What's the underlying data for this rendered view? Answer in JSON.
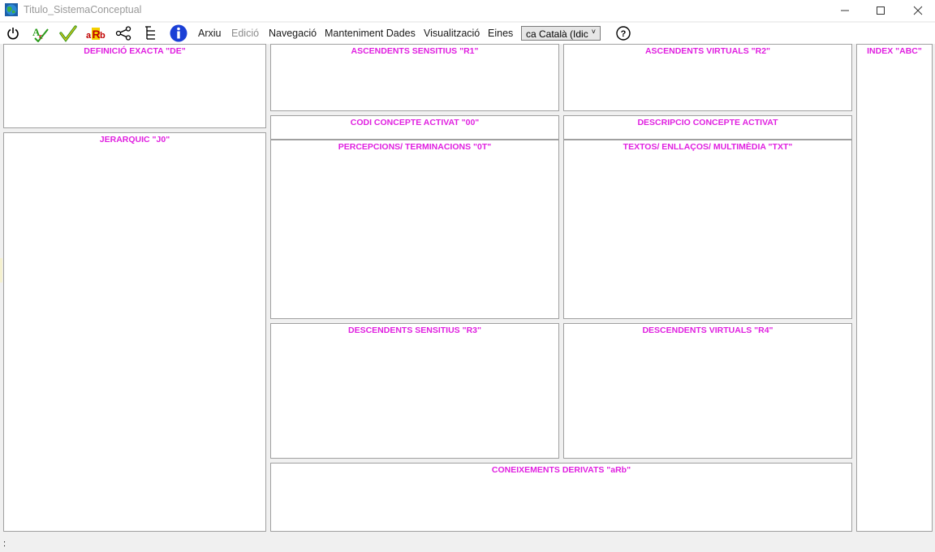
{
  "window": {
    "title": "Titulo_SistemaConceptual"
  },
  "menu": {
    "items": [
      {
        "label": "Arxiu",
        "enabled": true
      },
      {
        "label": "Edició",
        "enabled": false
      },
      {
        "label": "Navegació",
        "enabled": true
      },
      {
        "label": "Manteniment Dades",
        "enabled": true
      },
      {
        "label": "Visualització",
        "enabled": true
      },
      {
        "label": "Eines",
        "enabled": true
      }
    ],
    "language_value": "ca Català (Idic",
    "icons": [
      "power-icon",
      "spellcheck-icon",
      "checkmark-icon",
      "arb-icon",
      "share-icon",
      "tree-icon",
      "info-icon",
      "help-icon"
    ],
    "arb_icon_text": "aRb",
    "spell_icon_text": "ABC"
  },
  "panels": {
    "de": "DEFINICIÓ EXACTA \"DE\"",
    "r1": "ASCENDENTS SENSITIUS \"R1\"",
    "r2": "ASCENDENTS VIRTUALS \"R2\"",
    "abc": "INDEX \"ABC\"",
    "j0": "JERARQUIC \"J0\"",
    "c00": "CODI CONCEPTE ACTIVAT \"00\"",
    "desc": "DESCRIPCIO CONCEPTE ACTIVAT",
    "ot": "PERCEPCIONS/ TERMINACIONS \"0T\"",
    "txt": "TEXTOS/ ENLLAÇOS/ MULTIMÈDIA \"TXT\"",
    "r3": "DESCENDENTS SENSITIUS \"R3\"",
    "r4": "DESCENDENTS VIRTUALS \"R4\"",
    "arb": "CONEIXEMENTS DERIVATS \"aRb\""
  },
  "status": {
    "text": ":"
  },
  "colors": {
    "panel_title": "#e020e0",
    "info_blue": "#1a3fd6",
    "check_green": "#3a9a1a"
  }
}
